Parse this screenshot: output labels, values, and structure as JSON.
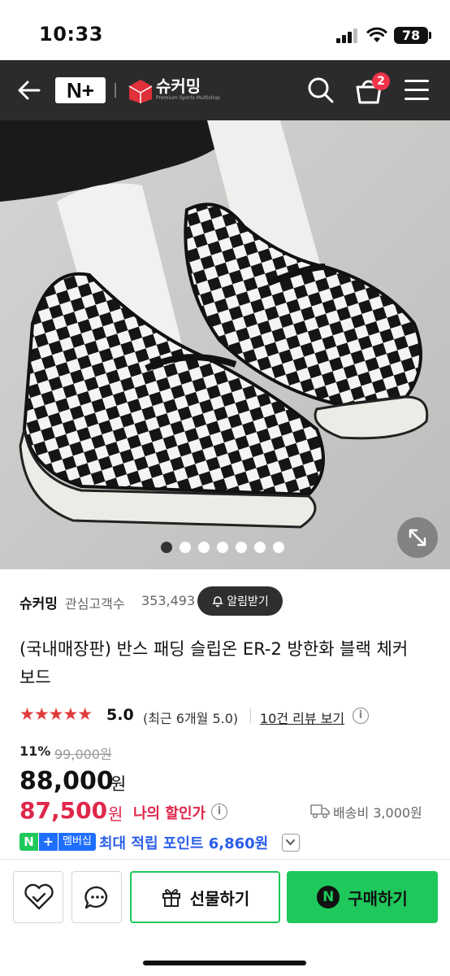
{
  "status_bar": {
    "time": "10:33",
    "battery": "78"
  },
  "nav": {
    "brand_logo": "N+",
    "shop_name": "슈커밍",
    "shop_tagline": "Premium Sports Multishop",
    "cart_count": "2",
    "icons": [
      "back-arrow-icon",
      "search-icon",
      "cart-icon",
      "menu-icon"
    ]
  },
  "gallery": {
    "total_images": 7,
    "active_index": 0
  },
  "store": {
    "name": "슈커밍",
    "follower_label": "관심고객수",
    "follower_count": "353,493",
    "alarm_label": "알림받기"
  },
  "product": {
    "title": "(국내매장판) 반스 패딩 슬립온 ER-2 방한화 블랙 체커 보드"
  },
  "rating": {
    "stars": "★★★★★",
    "value": "5.0",
    "recent": "(최근 6개월 5.0)",
    "review_link": "10건 리뷰 보기"
  },
  "price": {
    "discount_rate": "11%",
    "original": "99,000원",
    "sale": "88,000",
    "sale_unit": "원",
    "my_price": "87,500",
    "my_unit": "원",
    "my_label": "나의 할인가",
    "shipping": "배송비 3,000원"
  },
  "membership": {
    "badge_n": "N",
    "badge_plus": "+",
    "badge_label": "멤버십",
    "text": "최대 적립 포인트 6,860원"
  },
  "bottom": {
    "gift_label": "선물하기",
    "buy_label": "구매하기",
    "buy_badge": "N"
  },
  "colors": {
    "nav_bg": "#2b2b2b",
    "accent_green": "#1ec85b",
    "price_red": "#e0264a",
    "member_blue": "#2b5ee8",
    "star_red": "#e23a3a"
  }
}
